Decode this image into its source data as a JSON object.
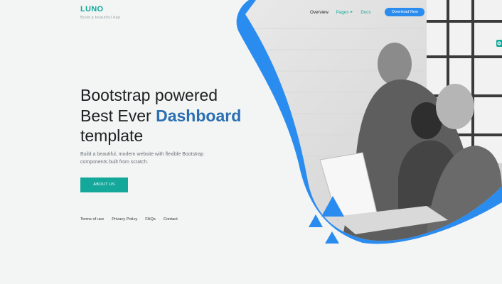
{
  "brand": {
    "name": "LUNO",
    "tagline": "Build a beautiful App"
  },
  "nav": {
    "items": [
      {
        "label": "Overview",
        "active": false
      },
      {
        "label": "Pages",
        "active": true,
        "dropdown": true
      },
      {
        "label": "Docs",
        "active": true
      }
    ],
    "download_label": "Download Now"
  },
  "hero": {
    "headline_before": "Bootstrap powered Best Ever ",
    "headline_highlight": "Dashboard",
    "headline_after": " template",
    "subtext": "Build a beautiful, modern website with flexible Bootstrap components built from scratch.",
    "cta_label": "ABOUT US"
  },
  "footer": {
    "links": [
      "Terms of use",
      "Privacy Policy",
      "FAQs",
      "Contact"
    ]
  },
  "colors": {
    "brand": "#14a89b",
    "accent_blue": "#2b8cf0",
    "headline_highlight": "#2a6fb3",
    "background": "#f3f5f4"
  },
  "icons": {
    "side_tab": "gear-icon",
    "nav_dropdown": "caret-down-icon"
  }
}
